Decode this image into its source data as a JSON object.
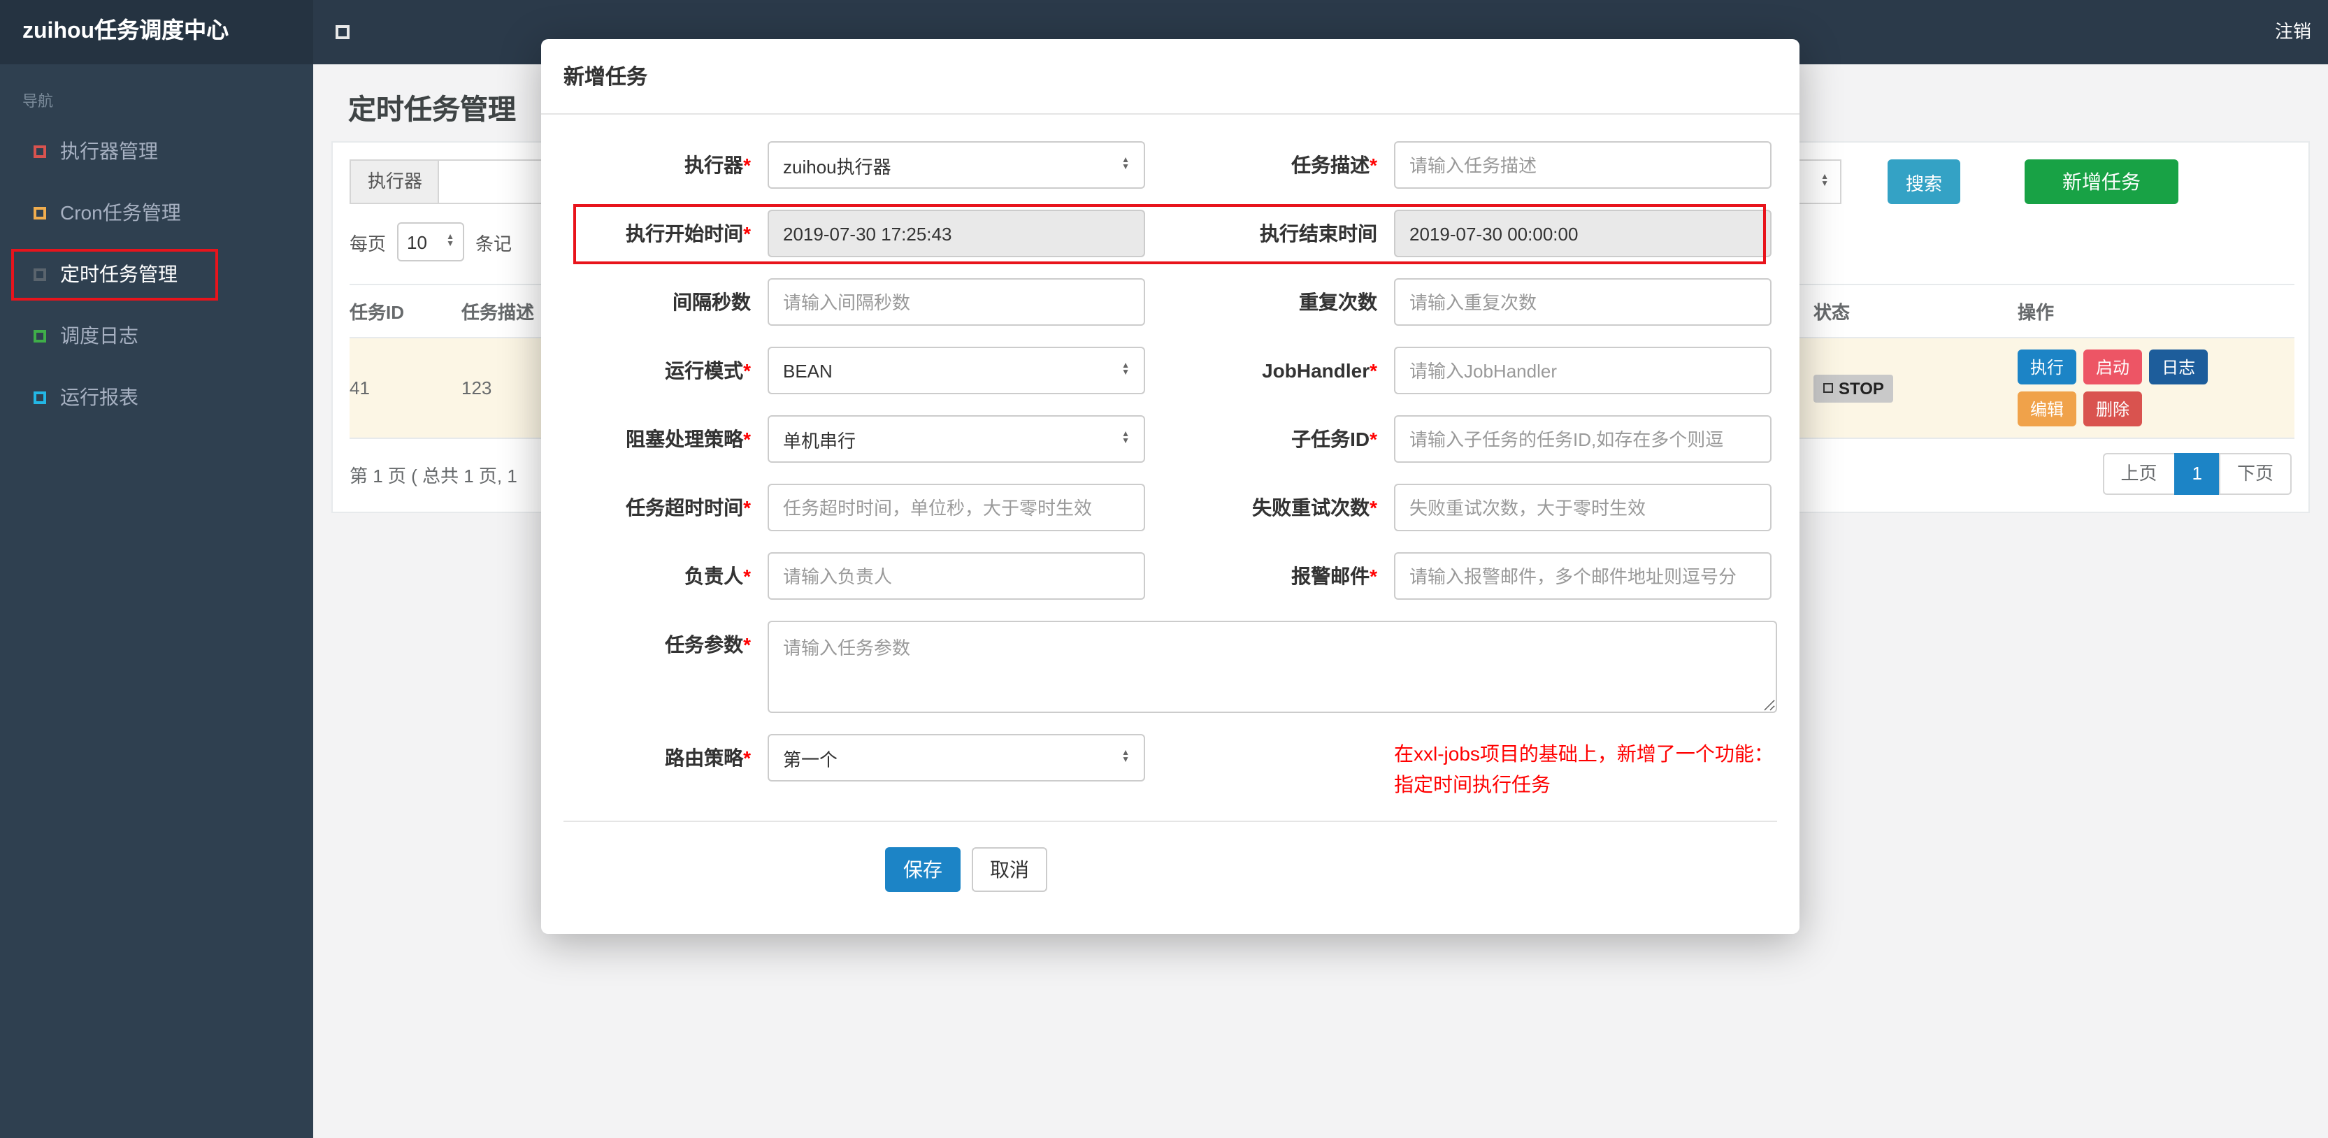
{
  "app": {
    "title": "zuihou任务调度中心",
    "logout": "注销"
  },
  "sidebar": {
    "nav_label": "导航",
    "items": [
      {
        "label": "执行器管理"
      },
      {
        "label": "Cron任务管理"
      },
      {
        "label": "定时任务管理"
      },
      {
        "label": "调度日志"
      },
      {
        "label": "运行报表"
      }
    ]
  },
  "page": {
    "title": "定时任务管理",
    "filter": {
      "executor_label": "执行器",
      "search": "搜索",
      "add": "新增任务"
    },
    "page_size": {
      "prefix": "每页",
      "value": "10",
      "suffix": "条记"
    },
    "table": {
      "headers": {
        "id": "任务ID",
        "desc": "任务描述",
        "status": "状态",
        "actions": "操作"
      },
      "row": {
        "id": "41",
        "desc": "123",
        "status": "STOP",
        "actions": [
          "执行",
          "启动",
          "日志",
          "编辑",
          "删除"
        ]
      }
    },
    "pagination": {
      "info": "第 1 页 ( 总共 1 页, 1",
      "prev": "上页",
      "current": "1",
      "next": "下页"
    }
  },
  "modal": {
    "title": "新增任务",
    "rows": [
      {
        "left": {
          "label": "执行器",
          "star": "*",
          "value": "zuihou执行器"
        },
        "right": {
          "label": "任务描述",
          "star": "*",
          "placeholder": "请输入任务描述"
        }
      },
      {
        "left": {
          "label": "执行开始时间",
          "star": "*",
          "value": "2019-07-30 17:25:43"
        },
        "right": {
          "label": "执行结束时间",
          "value": "2019-07-30 00:00:00"
        }
      },
      {
        "left": {
          "label": "间隔秒数",
          "placeholder": "请输入间隔秒数"
        },
        "right": {
          "label": "重复次数",
          "placeholder": "请输入重复次数"
        }
      },
      {
        "left": {
          "label": "运行模式",
          "star": "*",
          "value": "BEAN"
        },
        "right": {
          "label": "JobHandler",
          "star": "*",
          "placeholder": "请输入JobHandler"
        }
      },
      {
        "left": {
          "label": "阻塞处理策略",
          "star": "*",
          "value": "单机串行"
        },
        "right": {
          "label": "子任务ID",
          "star": "*",
          "placeholder": "请输入子任务的任务ID,如存在多个则逗"
        }
      },
      {
        "left": {
          "label": "任务超时时间",
          "star": "*",
          "placeholder": "任务超时时间，单位秒，大于零时生效"
        },
        "right": {
          "label": "失败重试次数",
          "star": "*",
          "placeholder": "失败重试次数，大于零时生效"
        }
      },
      {
        "left": {
          "label": "负责人",
          "star": "*",
          "placeholder": "请输入负责人"
        },
        "right": {
          "label": "报警邮件",
          "star": "*",
          "placeholder": "请输入报警邮件，多个邮件地址则逗号分"
        }
      },
      {
        "left": {
          "label": "任务参数",
          "star": "*",
          "placeholder": "请输入任务参数"
        }
      },
      {
        "left": {
          "label": "路由策略",
          "star": "*",
          "value": "第一个"
        }
      }
    ],
    "note": {
      "line1": "在xxl-jobs项目的基础上，新增了一个功能：",
      "line2": "指定时间执行任务"
    },
    "footer": {
      "save": "保存",
      "cancel": "取消"
    }
  },
  "colors": {
    "topbar_bg": "#2b3a4a",
    "sidebar_bg": "#2f4050",
    "accent_blue": "#1c84c6",
    "search_button": "#34a2c5",
    "add_button": "#18a245",
    "status_stop_bg": "#c9c9c9",
    "btn_start": "#ed5565",
    "btn_log": "#1d5d9b",
    "btn_edit": "#f0a24a",
    "btn_delete": "#d9534f",
    "annotation_red": "#e8141c",
    "note_red": "#ff0000",
    "required_red": "#ff0000"
  }
}
